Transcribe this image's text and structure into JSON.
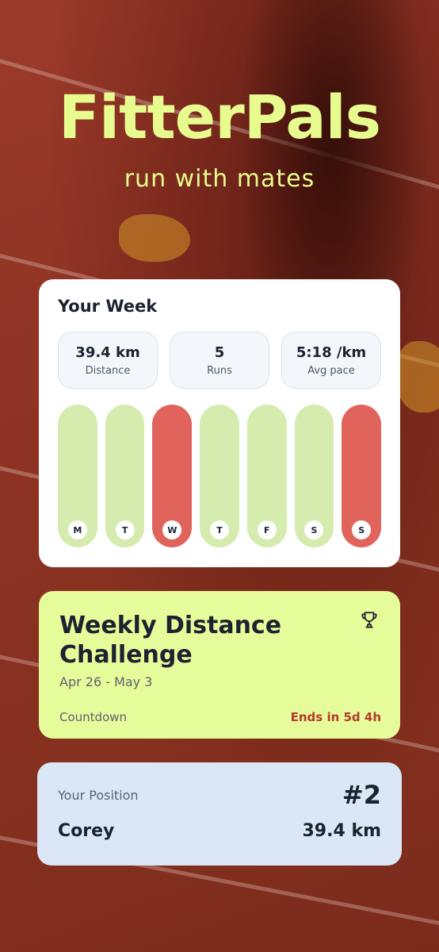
{
  "app": {
    "title": "FitterPals",
    "tagline": "run with mates"
  },
  "week": {
    "title": "Your Week",
    "stats": [
      {
        "value": "39.4 km",
        "label": "Distance"
      },
      {
        "value": "5",
        "label": "Runs"
      },
      {
        "value": "5:18 /km",
        "label": "Avg pace"
      }
    ],
    "days": [
      {
        "label": "M",
        "status": "easy"
      },
      {
        "label": "T",
        "status": "easy"
      },
      {
        "label": "W",
        "status": "hard"
      },
      {
        "label": "T",
        "status": "easy"
      },
      {
        "label": "F",
        "status": "easy"
      },
      {
        "label": "S",
        "status": "easy"
      },
      {
        "label": "S",
        "status": "hard"
      }
    ],
    "colors": {
      "easy": "#d5ecae",
      "hard": "#e0645c"
    }
  },
  "challenge": {
    "title": "Weekly Distance Challenge",
    "dates": "Apr 26 - May 3",
    "countdown_label": "Countdown",
    "countdown_value": "Ends in 5d 4h",
    "icon": "trophy-icon"
  },
  "position": {
    "label": "Your Position",
    "rank": "#2",
    "name": "Corey",
    "distance": "39.4 km"
  }
}
